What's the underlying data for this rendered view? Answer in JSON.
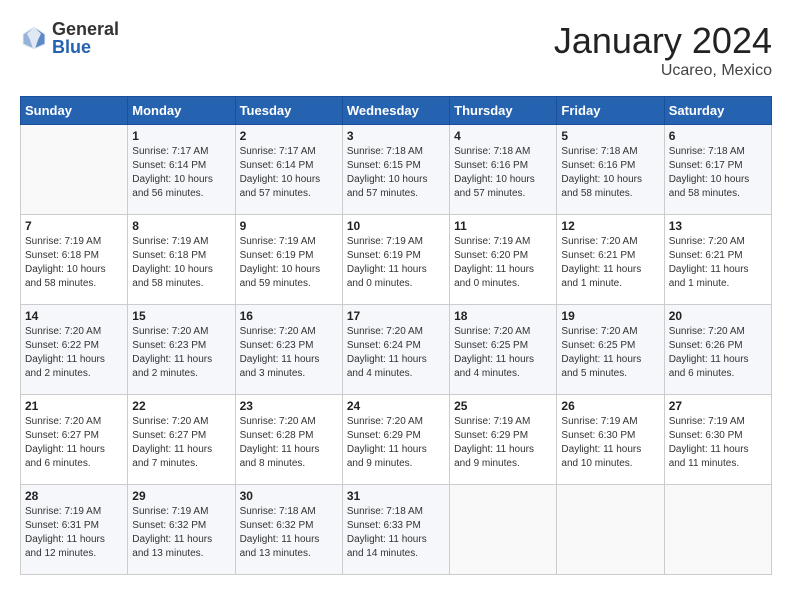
{
  "header": {
    "logo_general": "General",
    "logo_blue": "Blue",
    "month_title": "January 2024",
    "location": "Ucareo, Mexico"
  },
  "days_of_week": [
    "Sunday",
    "Monday",
    "Tuesday",
    "Wednesday",
    "Thursday",
    "Friday",
    "Saturday"
  ],
  "weeks": [
    [
      {
        "day": "",
        "sunrise": "",
        "sunset": "",
        "daylight": ""
      },
      {
        "day": "1",
        "sunrise": "7:17 AM",
        "sunset": "6:14 PM",
        "daylight": "10 hours and 56 minutes."
      },
      {
        "day": "2",
        "sunrise": "7:17 AM",
        "sunset": "6:14 PM",
        "daylight": "10 hours and 57 minutes."
      },
      {
        "day": "3",
        "sunrise": "7:18 AM",
        "sunset": "6:15 PM",
        "daylight": "10 hours and 57 minutes."
      },
      {
        "day": "4",
        "sunrise": "7:18 AM",
        "sunset": "6:16 PM",
        "daylight": "10 hours and 57 minutes."
      },
      {
        "day": "5",
        "sunrise": "7:18 AM",
        "sunset": "6:16 PM",
        "daylight": "10 hours and 58 minutes."
      },
      {
        "day": "6",
        "sunrise": "7:18 AM",
        "sunset": "6:17 PM",
        "daylight": "10 hours and 58 minutes."
      }
    ],
    [
      {
        "day": "7",
        "sunrise": "7:19 AM",
        "sunset": "6:18 PM",
        "daylight": "10 hours and 58 minutes."
      },
      {
        "day": "8",
        "sunrise": "7:19 AM",
        "sunset": "6:18 PM",
        "daylight": "10 hours and 58 minutes."
      },
      {
        "day": "9",
        "sunrise": "7:19 AM",
        "sunset": "6:19 PM",
        "daylight": "10 hours and 59 minutes."
      },
      {
        "day": "10",
        "sunrise": "7:19 AM",
        "sunset": "6:19 PM",
        "daylight": "11 hours and 0 minutes."
      },
      {
        "day": "11",
        "sunrise": "7:19 AM",
        "sunset": "6:20 PM",
        "daylight": "11 hours and 0 minutes."
      },
      {
        "day": "12",
        "sunrise": "7:20 AM",
        "sunset": "6:21 PM",
        "daylight": "11 hours and 1 minute."
      },
      {
        "day": "13",
        "sunrise": "7:20 AM",
        "sunset": "6:21 PM",
        "daylight": "11 hours and 1 minute."
      }
    ],
    [
      {
        "day": "14",
        "sunrise": "7:20 AM",
        "sunset": "6:22 PM",
        "daylight": "11 hours and 2 minutes."
      },
      {
        "day": "15",
        "sunrise": "7:20 AM",
        "sunset": "6:23 PM",
        "daylight": "11 hours and 2 minutes."
      },
      {
        "day": "16",
        "sunrise": "7:20 AM",
        "sunset": "6:23 PM",
        "daylight": "11 hours and 3 minutes."
      },
      {
        "day": "17",
        "sunrise": "7:20 AM",
        "sunset": "6:24 PM",
        "daylight": "11 hours and 4 minutes."
      },
      {
        "day": "18",
        "sunrise": "7:20 AM",
        "sunset": "6:25 PM",
        "daylight": "11 hours and 4 minutes."
      },
      {
        "day": "19",
        "sunrise": "7:20 AM",
        "sunset": "6:25 PM",
        "daylight": "11 hours and 5 minutes."
      },
      {
        "day": "20",
        "sunrise": "7:20 AM",
        "sunset": "6:26 PM",
        "daylight": "11 hours and 6 minutes."
      }
    ],
    [
      {
        "day": "21",
        "sunrise": "7:20 AM",
        "sunset": "6:27 PM",
        "daylight": "11 hours and 6 minutes."
      },
      {
        "day": "22",
        "sunrise": "7:20 AM",
        "sunset": "6:27 PM",
        "daylight": "11 hours and 7 minutes."
      },
      {
        "day": "23",
        "sunrise": "7:20 AM",
        "sunset": "6:28 PM",
        "daylight": "11 hours and 8 minutes."
      },
      {
        "day": "24",
        "sunrise": "7:20 AM",
        "sunset": "6:29 PM",
        "daylight": "11 hours and 9 minutes."
      },
      {
        "day": "25",
        "sunrise": "7:19 AM",
        "sunset": "6:29 PM",
        "daylight": "11 hours and 9 minutes."
      },
      {
        "day": "26",
        "sunrise": "7:19 AM",
        "sunset": "6:30 PM",
        "daylight": "11 hours and 10 minutes."
      },
      {
        "day": "27",
        "sunrise": "7:19 AM",
        "sunset": "6:30 PM",
        "daylight": "11 hours and 11 minutes."
      }
    ],
    [
      {
        "day": "28",
        "sunrise": "7:19 AM",
        "sunset": "6:31 PM",
        "daylight": "11 hours and 12 minutes."
      },
      {
        "day": "29",
        "sunrise": "7:19 AM",
        "sunset": "6:32 PM",
        "daylight": "11 hours and 13 minutes."
      },
      {
        "day": "30",
        "sunrise": "7:18 AM",
        "sunset": "6:32 PM",
        "daylight": "11 hours and 13 minutes."
      },
      {
        "day": "31",
        "sunrise": "7:18 AM",
        "sunset": "6:33 PM",
        "daylight": "11 hours and 14 minutes."
      },
      {
        "day": "",
        "sunrise": "",
        "sunset": "",
        "daylight": ""
      },
      {
        "day": "",
        "sunrise": "",
        "sunset": "",
        "daylight": ""
      },
      {
        "day": "",
        "sunrise": "",
        "sunset": "",
        "daylight": ""
      }
    ]
  ]
}
